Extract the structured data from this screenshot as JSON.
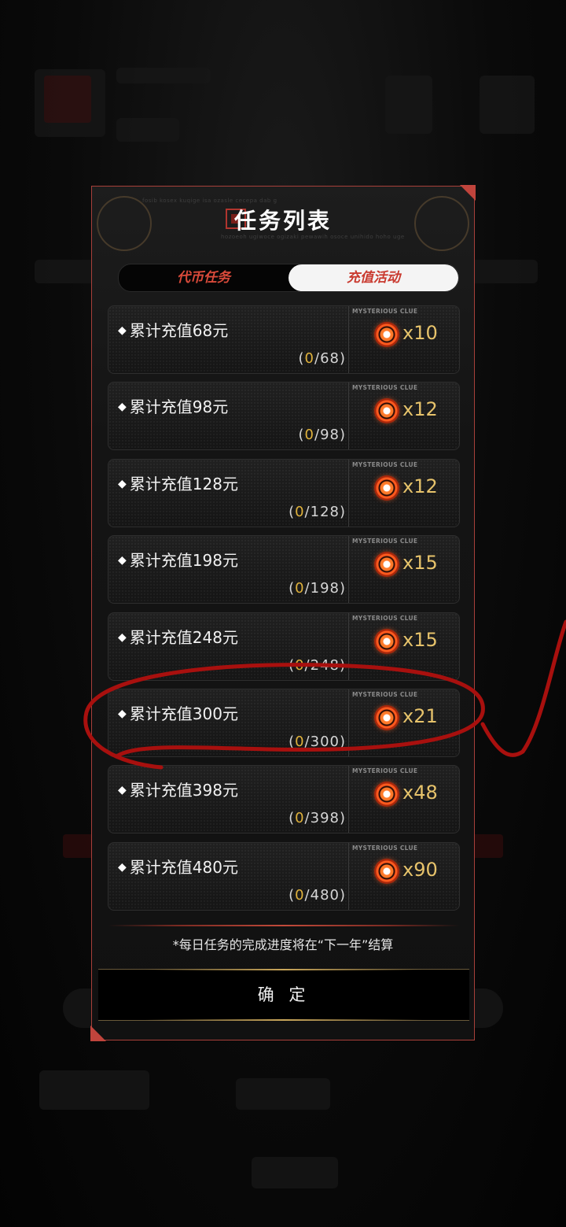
{
  "dialog": {
    "title": "任务列表",
    "deco_text_1": "fosib kosex kuqige isa ozasle cecepa dab g",
    "deco_text_2": "hozoeoh ugiwoce ogizaki pewawih osoce unihido hoho uge"
  },
  "tabs": [
    {
      "label": "代币任务",
      "active": false
    },
    {
      "label": "充值活动",
      "active": true
    }
  ],
  "reward_caption": "MYSTERIOUS CLUE",
  "tasks": [
    {
      "name": "累计充值68元",
      "progress_open": "(",
      "progress_current": "0",
      "progress_rest": "/68)",
      "reward": "x10"
    },
    {
      "name": "累计充值98元",
      "progress_open": "(",
      "progress_current": "0",
      "progress_rest": "/98)",
      "reward": "x12"
    },
    {
      "name": "累计充值128元",
      "progress_open": "(",
      "progress_current": "0",
      "progress_rest": "/128)",
      "reward": "x12"
    },
    {
      "name": "累计充值198元",
      "progress_open": "(",
      "progress_current": "0",
      "progress_rest": "/198)",
      "reward": "x15"
    },
    {
      "name": "累计充值248元",
      "progress_open": "(",
      "progress_current": "0",
      "progress_rest": "/248)",
      "reward": "x15"
    },
    {
      "name": "累计充值300元",
      "progress_open": "(",
      "progress_current": "0",
      "progress_rest": "/300)",
      "reward": "x21"
    },
    {
      "name": "累计充值398元",
      "progress_open": "(",
      "progress_current": "0",
      "progress_rest": "/398)",
      "reward": "x48"
    },
    {
      "name": "累计充值480元",
      "progress_open": "(",
      "progress_current": "0",
      "progress_rest": "/480)",
      "reward": "x90"
    }
  ],
  "note": "*每日任务的完成进度将在“下一年”结算",
  "confirm_label": "确 定",
  "colors": {
    "accent_red": "#c9392e",
    "reward_gold": "#e7c36b",
    "progress_gold": "#e0b23c",
    "annotation_red": "#a8100e"
  }
}
